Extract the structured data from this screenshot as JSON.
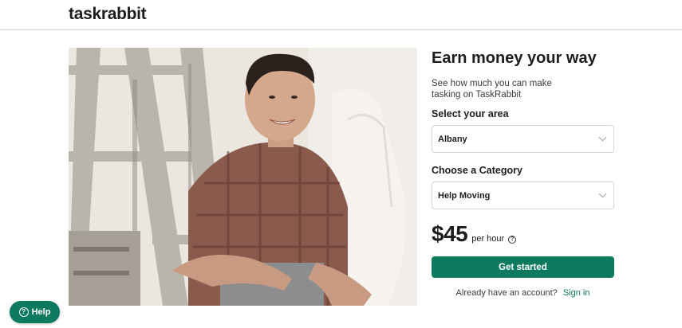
{
  "header": {
    "logo": "taskrabbit"
  },
  "hero": {
    "image_alt": "smiling tasker sitting by a ladder"
  },
  "panel": {
    "title": "Earn money your way",
    "subtitle": "See how much you can make tasking on TaskRabbit",
    "area_label": "Select your area",
    "area_value": "Albany",
    "category_label": "Choose a Category",
    "category_value": "Help Moving",
    "price": "$45",
    "per_unit": "per hour",
    "cta_label": "Get started",
    "account_prompt": "Already have an account?",
    "signin_label": "Sign in"
  },
  "help": {
    "label": "Help",
    "icon_glyph": "?"
  },
  "colors": {
    "brand": "#0d7a5f",
    "text": "#1d1d1d",
    "border": "#d6d6d6"
  }
}
